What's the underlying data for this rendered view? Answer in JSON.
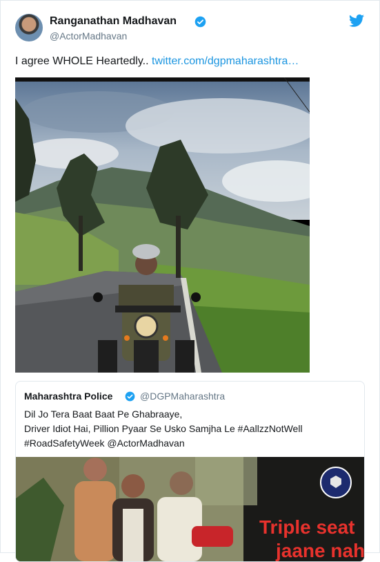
{
  "author": {
    "name": "Ranganathan Madhavan",
    "handle": "@ActorMadhavan"
  },
  "tweet": {
    "text": "I agree WHOLE Heartedly.. ",
    "link": "twitter.com/dgpmaharashtra…"
  },
  "quoted": {
    "name": "Maharashtra Police",
    "handle": "@DGPMaharashtra",
    "lines": [
      "Dil Jo Tera Baat Baat Pe Ghabraaye,",
      "Driver Idiot Hai, Pillion Pyaar Se Usko Samjha Le  #AallzzNotWell",
      "#RoadSafetyWeek @ActorMadhavan"
    ],
    "poster_text": [
      "Triple seat",
      "jaane nahi"
    ]
  },
  "colors": {
    "link": "#1b95e0",
    "verified": "#1da1f2",
    "twitter_brand": "#1da1f2",
    "poster_text": "#e8322d"
  },
  "icons": {
    "verified": "verified-badge-icon",
    "brand": "twitter-bird-icon"
  }
}
